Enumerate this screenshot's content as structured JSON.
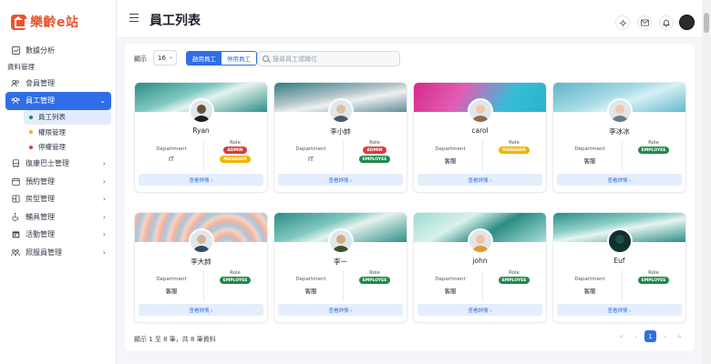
{
  "app": {
    "logo_text": "樂齡e站"
  },
  "header": {
    "title": "員工列表"
  },
  "sidebar": {
    "items": [
      {
        "label": "數據分析",
        "icon": "chart-icon"
      },
      {
        "section": "資料管理"
      },
      {
        "label": "會員管理",
        "icon": "users-icon"
      },
      {
        "label": "員工管理",
        "icon": "team-icon",
        "active": true,
        "chevron": "v"
      },
      {
        "label": "員工列表",
        "sub": true,
        "active": true,
        "dot_color": "#1f8a4c"
      },
      {
        "label": "權限管理",
        "sub": true,
        "dot_color": "#f2b300"
      },
      {
        "label": "停權管理",
        "sub": true,
        "dot_color": "#d93b3b"
      },
      {
        "label": "復康巴士管理",
        "icon": "bus-icon",
        "chevron": ">"
      },
      {
        "label": "預約管理",
        "icon": "calendar-icon",
        "chevron": ">"
      },
      {
        "label": "房型管理",
        "icon": "room-icon",
        "chevron": ">"
      },
      {
        "label": "輔具管理",
        "icon": "wheelchair-icon",
        "chevron": ">"
      },
      {
        "label": "活動管理",
        "icon": "event-icon",
        "chevron": ">"
      },
      {
        "label": "照服員管理",
        "icon": "caregiver-icon",
        "chevron": ">"
      }
    ]
  },
  "toolbar": {
    "show_label": "顯示",
    "per_page": "16",
    "seg_active": "啟用員工",
    "seg_inactive": "停用員工",
    "search_placeholder": "搜尋員工或職位"
  },
  "card_labels": {
    "department": "Department",
    "role": "Role",
    "detail": "查看詳情 ›"
  },
  "cards": [
    {
      "name": "Ryan",
      "department": "IT",
      "roles": [
        "ADMIN",
        "MANAGER"
      ],
      "banner": "teal"
    },
    {
      "name": "李小帥",
      "department": "IT",
      "roles": [
        "ADMIN",
        "EMPLOYEE"
      ],
      "banner": "silver"
    },
    {
      "name": "carol",
      "department": "客服",
      "roles": [
        "MANAGER"
      ],
      "banner": "magenta"
    },
    {
      "name": "李冰冰",
      "department": "客服",
      "roles": [
        "EMPLOYEE"
      ],
      "banner": "sky"
    },
    {
      "name": "李大帥",
      "department": "客服",
      "roles": [
        "EMPLOYEE"
      ],
      "banner": "swirl"
    },
    {
      "name": "李一",
      "department": "客服",
      "roles": [
        "EMPLOYEE"
      ],
      "banner": "teal"
    },
    {
      "name": "john",
      "department": "客服",
      "roles": [
        "EMPLOYEE"
      ],
      "banner": "teal2"
    },
    {
      "name": "Euf",
      "department": "客服",
      "roles": [
        "EMPLOYEE"
      ],
      "banner": "teal3"
    }
  ],
  "footer": {
    "summary": "顯示 1 至 8 筆，共 8 筆資料",
    "current_page": "1"
  },
  "pager": {
    "first": "«",
    "prev": "‹",
    "next": "›",
    "last": "»"
  },
  "colors": {
    "accent": "#2f6ee6",
    "admin": "#d93b3b",
    "manager": "#f2b300",
    "employee": "#1f8a4c"
  }
}
